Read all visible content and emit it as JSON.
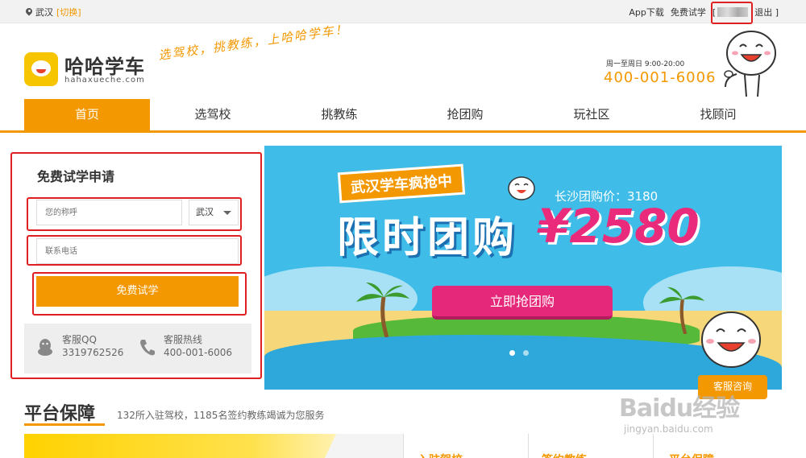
{
  "topbar": {
    "city": "武汉",
    "switch_label": "[切换]",
    "app_download": "App下载",
    "free_trial": "免费试学",
    "bracket_open": "[",
    "logout": "退出 ]"
  },
  "header": {
    "brand_name": "哈哈学车",
    "brand_domain": "hahaxueche.com",
    "slogan": "选驾校，挑教练，上哈哈学车！",
    "hours": "周一至周日 9:00-20:00",
    "hotline": "400-001-6006"
  },
  "nav": {
    "items": [
      {
        "label": "首页",
        "active": true
      },
      {
        "label": "选驾校",
        "active": false
      },
      {
        "label": "挑教练",
        "active": false
      },
      {
        "label": "抢团购",
        "active": false
      },
      {
        "label": "玩社区",
        "active": false
      },
      {
        "label": "找顾问",
        "active": false
      }
    ]
  },
  "form": {
    "title": "免费试学申请",
    "name_placeholder": "您的称呼",
    "city_value": "武汉",
    "phone_placeholder": "联系电话",
    "submit_label": "免费试学",
    "qq_label": "客服QQ",
    "qq_value": "3319762526",
    "hotline_label": "客服热线",
    "hotline_value": "400-001-6006"
  },
  "banner": {
    "tag": "武汉学车疯抢中",
    "original_price": "长沙团购价：3180",
    "headline": "限时团购",
    "price": "¥2580",
    "button_label": "立即抢团购",
    "dots": 2,
    "active_dot": 0
  },
  "kefu": {
    "label": "客服咨询"
  },
  "section": {
    "title": "平台保障",
    "description": "132所入驻驾校，1185名签约教练竭诚为您服务",
    "columns": [
      "入驻驾校",
      "签约教练",
      "平台保障"
    ]
  },
  "watermark": {
    "main": "Baidu经验",
    "sub": "jingyan.baidu.com"
  },
  "colors": {
    "accent": "#f39800",
    "banner_bg": "#3fbde8",
    "banner_button": "#e6287a",
    "highlight_box": "#e02020"
  }
}
